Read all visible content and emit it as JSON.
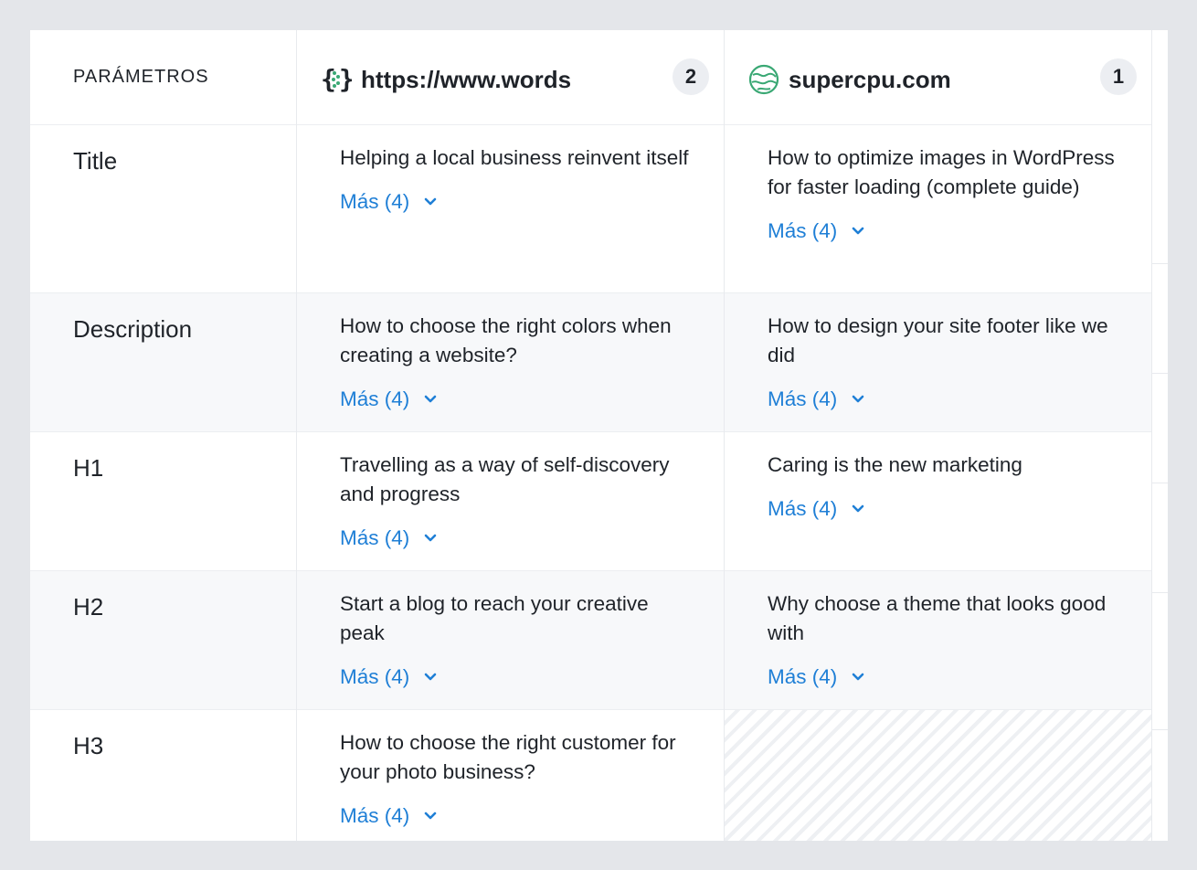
{
  "header": {
    "params_label": "PARÁMETROS",
    "sites": [
      {
        "name": "https://www.words",
        "count": "2",
        "icon": "brackets-logo-icon"
      },
      {
        "name": "supercpu.com",
        "count": "1",
        "icon": "green-globe-logo-icon"
      }
    ]
  },
  "rows": [
    {
      "param": "Title",
      "site1": "Helping a local business reinvent itself",
      "site1_more": "Más (4)",
      "site2": "How to optimize images in WordPress for faster loading (complete guide)",
      "site2_more": "Más (4)"
    },
    {
      "param": "Description",
      "site1": "How to choose the right colors when creating a website?",
      "site1_more": "Más (4)",
      "site2": "How to design your site footer like we did",
      "site2_more": "Más (4)"
    },
    {
      "param": "H1",
      "site1": "Travelling as a way of self-discovery and progress",
      "site1_more": "Más (4)",
      "site2": "Caring is the new marketing",
      "site2_more": "Más (4)"
    },
    {
      "param": "H2",
      "site1": "Start a blog to reach your creative peak",
      "site1_more": "Más (4)",
      "site2": "Why choose a theme that looks good with",
      "site2_more": "Más (4)"
    },
    {
      "param": "H3",
      "site1": "How to choose the right customer for your photo business?",
      "site1_more": "Más (4)"
    }
  ],
  "colors": {
    "link": "#1f7fd6",
    "alt_row": "#f7f8fa",
    "brand_green": "#3aa874"
  }
}
